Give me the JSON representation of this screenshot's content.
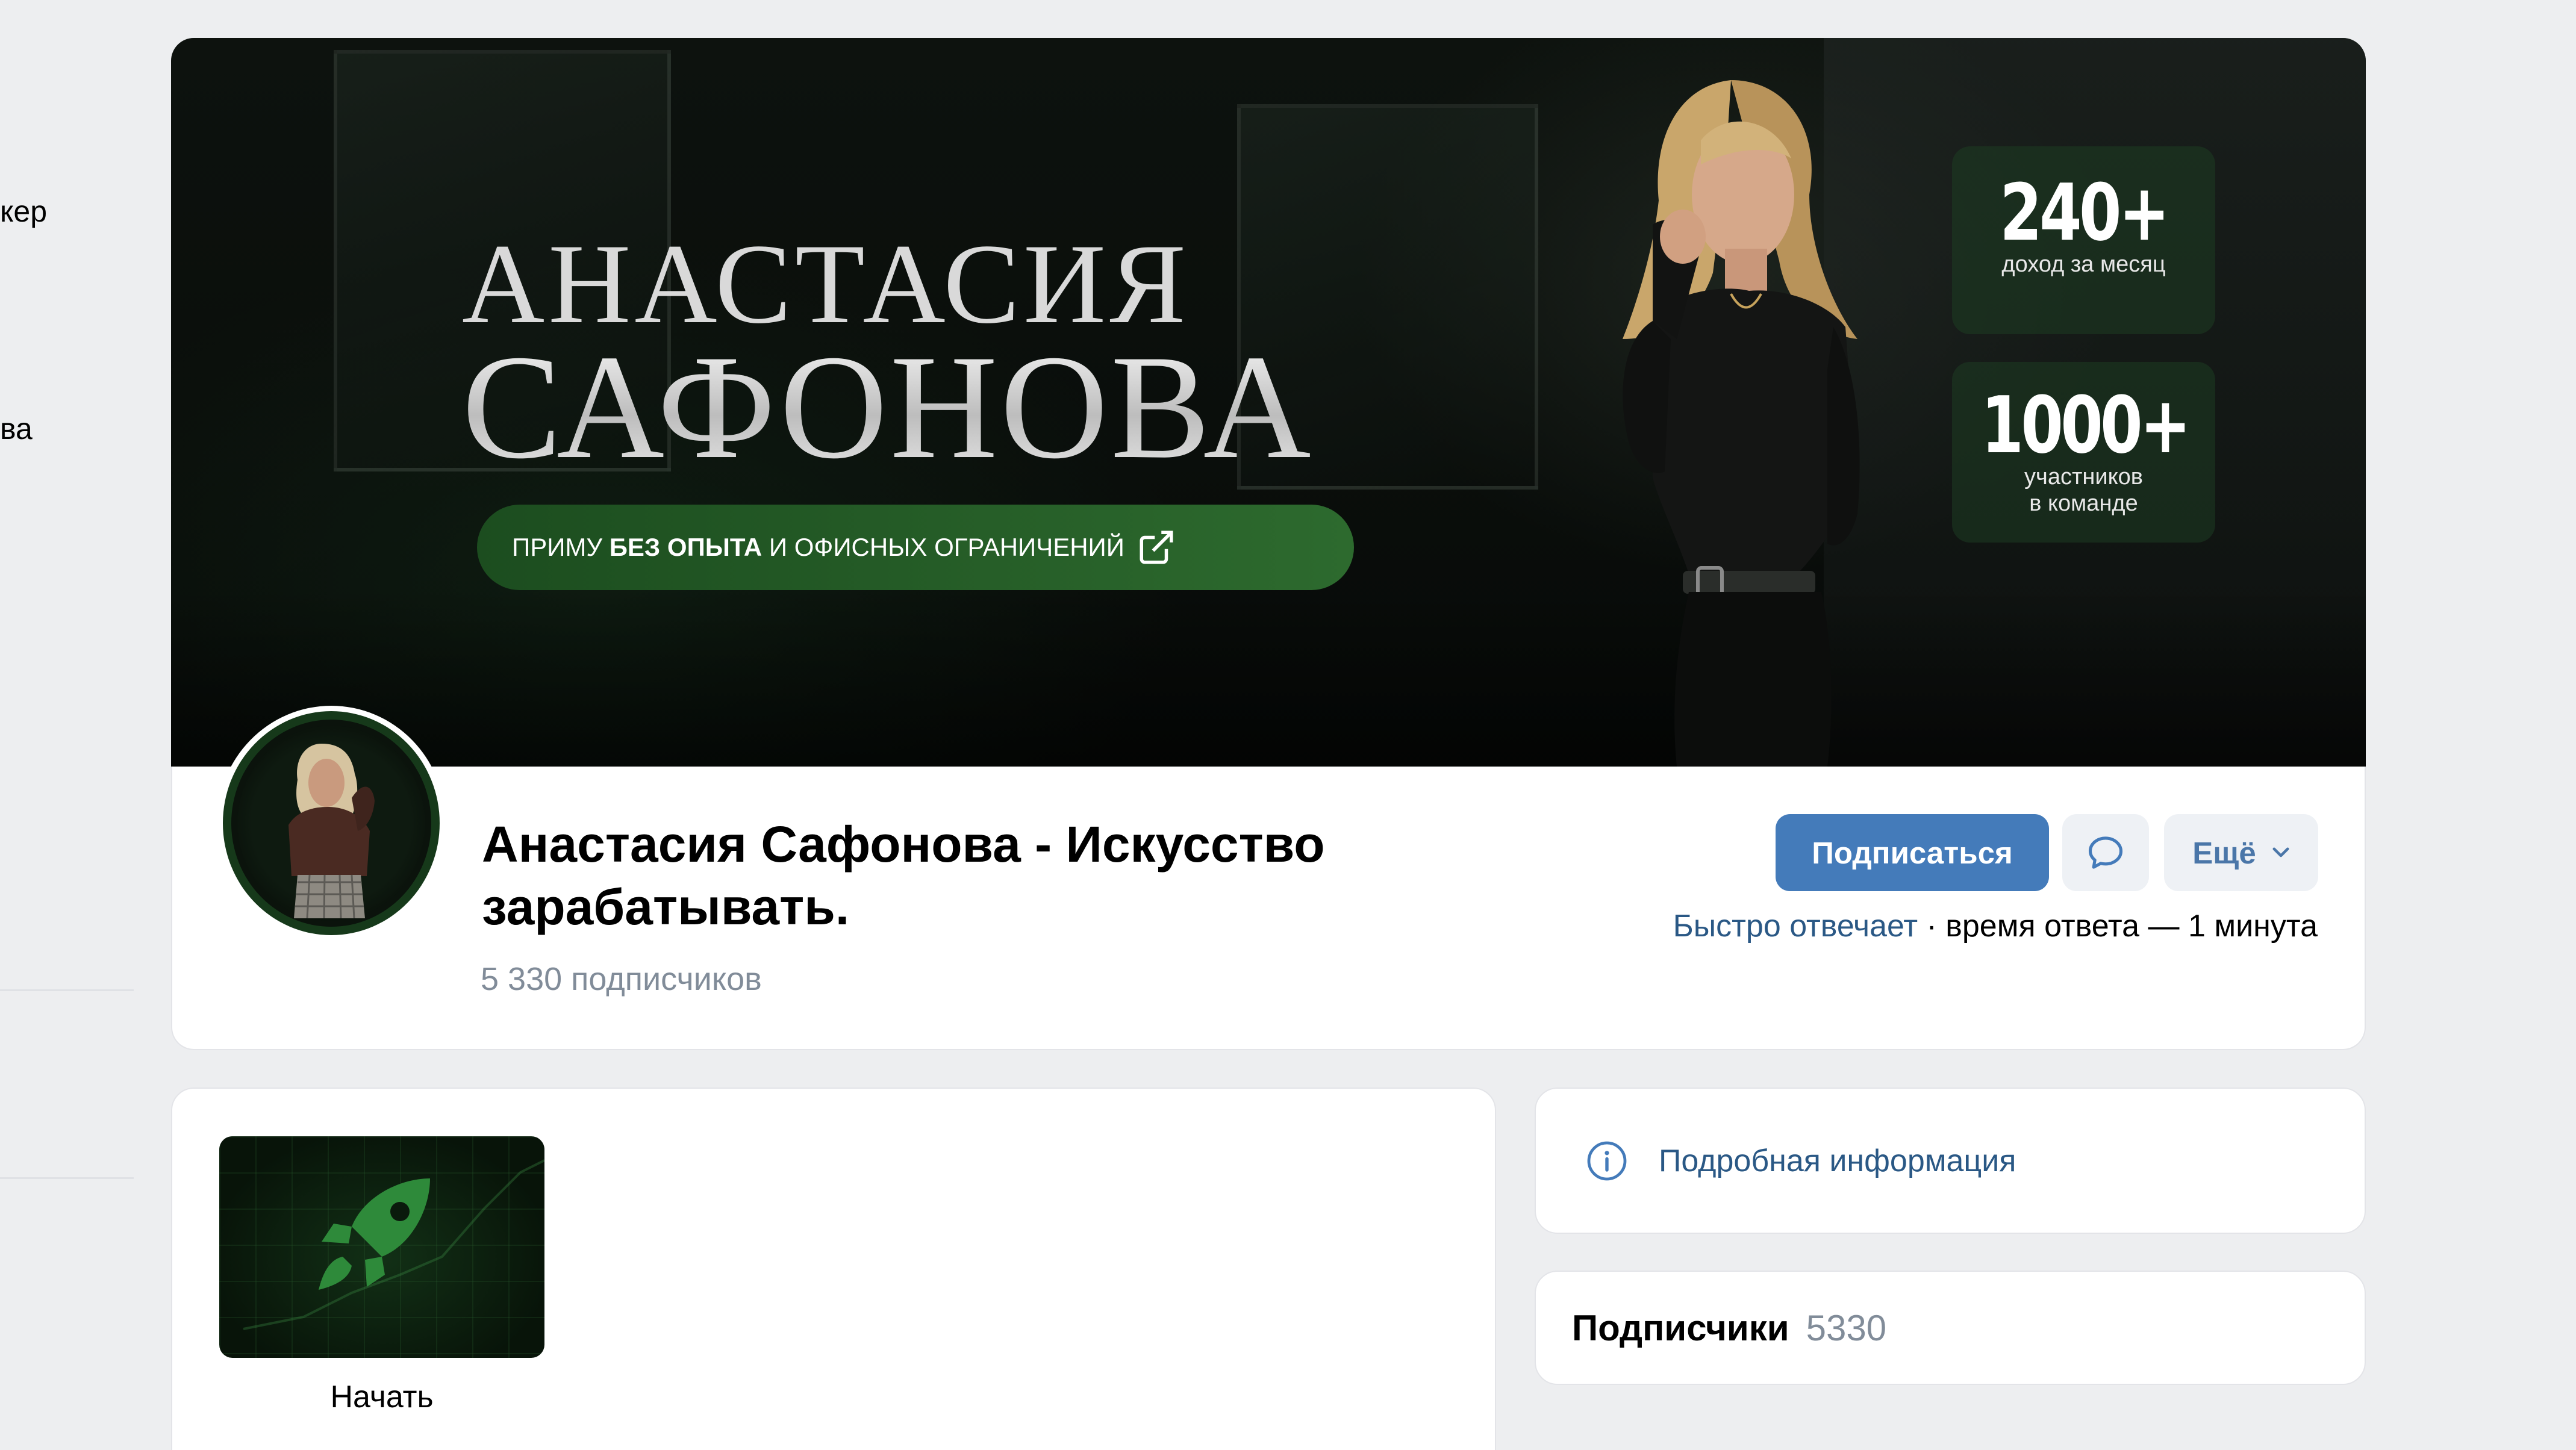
{
  "sidebar": {
    "fragment_1": "кер",
    "fragment_2": "ва"
  },
  "cover": {
    "name_line_1": "АНАСТАСИЯ",
    "name_line_2": "САФОНОВА",
    "tagline_pre": "ПРИМУ",
    "tagline_bold": "БЕЗ ОПЫТА",
    "tagline_post": "И ОФИСНЫХ ОГРАНИЧЕНИЙ",
    "stats": [
      {
        "value": "240+",
        "caption_1": "доход за месяц",
        "caption_2": ""
      },
      {
        "value": "1000+",
        "caption_1": "участников",
        "caption_2": "в команде"
      }
    ]
  },
  "profile": {
    "title": "Анастасия Сафонова - Искусство зарабатывать.",
    "subscribers_num": "5 330",
    "subscribers_label": "подписчиков",
    "subscribe_label": "Подписаться",
    "more_label": "Ещё",
    "response_fast": "Быстро отвечает",
    "response_rest": " · время ответа — 1 минута"
  },
  "widget": {
    "label": "Начать"
  },
  "info": {
    "label": "Подробная информация"
  },
  "subscribers_block": {
    "title": "Подписчики",
    "count": "5330"
  },
  "colors": {
    "accent": "#447bba",
    "link": "#2a5885",
    "muted": "#818c99",
    "cover_green": "#2d6a2e"
  }
}
